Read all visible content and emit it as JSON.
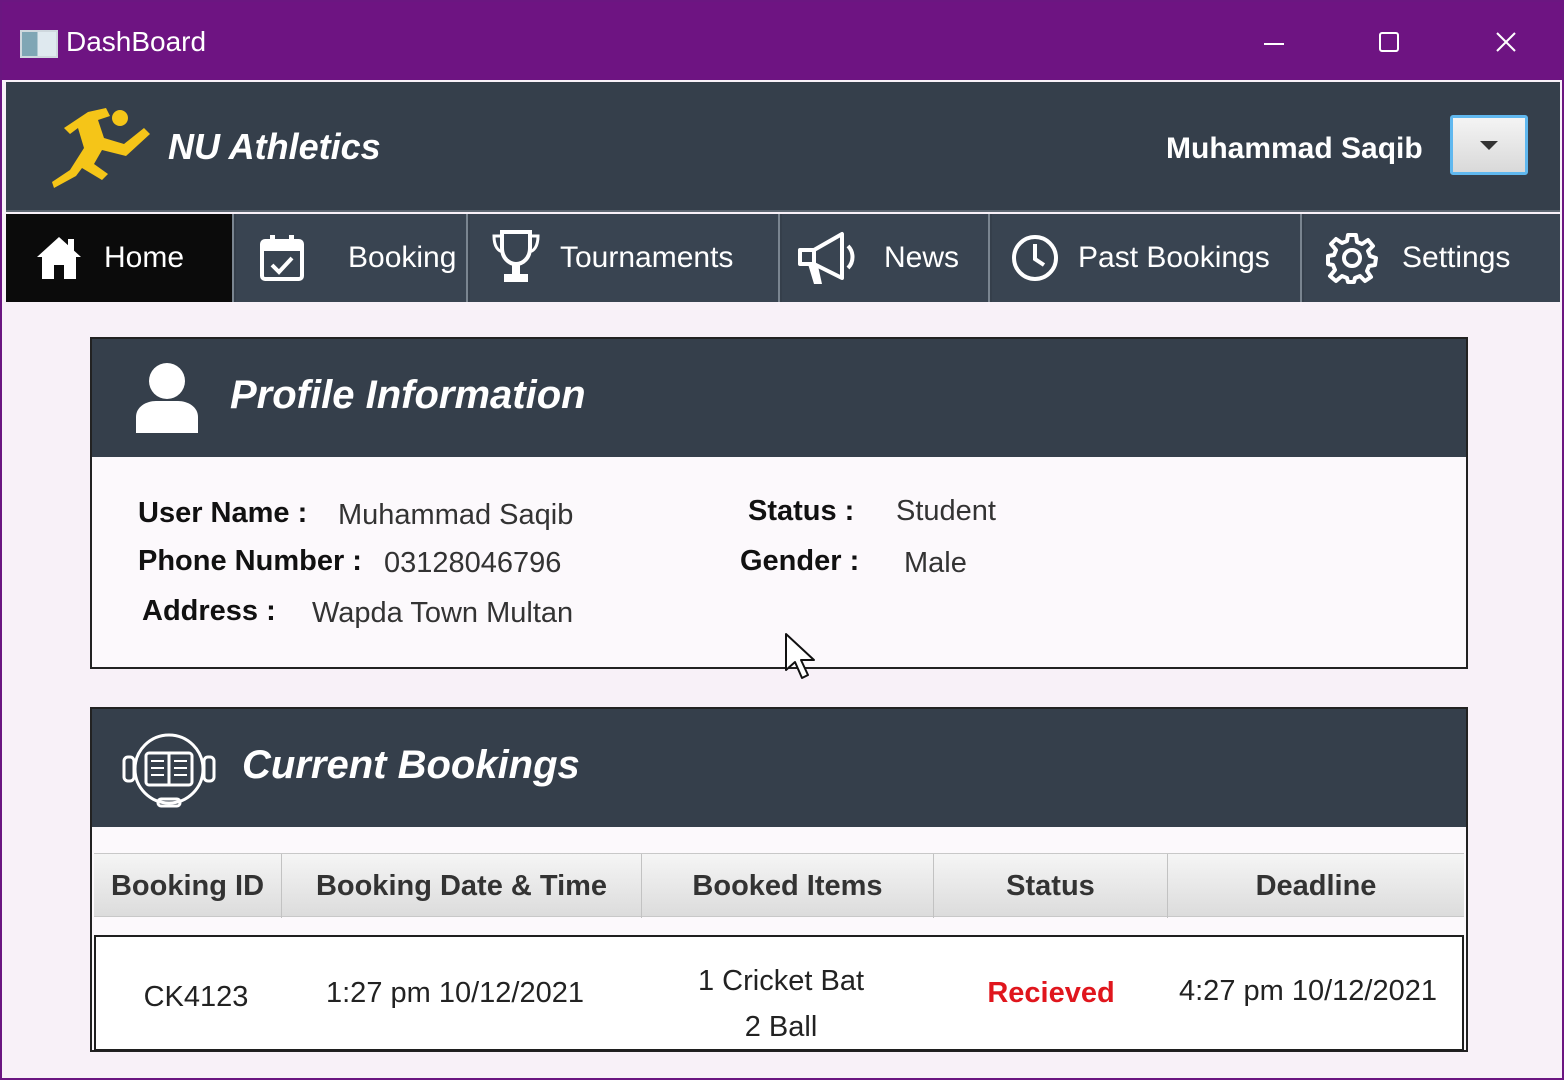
{
  "window": {
    "title": "DashBoard",
    "controls": [
      "minimize",
      "maximize",
      "close"
    ]
  },
  "header": {
    "brand": "NU Athletics",
    "user_name": "Muhammad Saqib",
    "logo_icon": "runner-icon"
  },
  "nav": {
    "items": [
      {
        "label": "Home",
        "icon": "home-icon",
        "active": true
      },
      {
        "label": "Booking",
        "icon": "calendar-check-icon",
        "active": false
      },
      {
        "label": "Tournaments",
        "icon": "trophy-icon",
        "active": false
      },
      {
        "label": "News",
        "icon": "megaphone-icon",
        "active": false
      },
      {
        "label": "Past Bookings",
        "icon": "clock-icon",
        "active": false
      },
      {
        "label": "Settings",
        "icon": "gear-icon",
        "active": false
      }
    ]
  },
  "profile": {
    "title": "Profile Information",
    "user_name_label": "User Name :",
    "user_name": "Muhammad Saqib",
    "phone_label": "Phone Number :",
    "phone": "03128046796",
    "address_label": "Address :",
    "address": "Wapda Town Multan",
    "status_label": "Status :",
    "status": "Student",
    "gender_label": "Gender :",
    "gender": "Male"
  },
  "bookings": {
    "title": "Current Bookings",
    "columns": [
      "Booking ID",
      "Booking Date & Time",
      "Booked Items",
      "Status",
      "Deadline"
    ],
    "rows": [
      {
        "id": "CK4123",
        "datetime": "1:27 pm 10/12/2021",
        "items": [
          "1 Cricket Bat",
          "2 Ball"
        ],
        "status": "Recieved",
        "deadline": "4:27 pm 10/12/2021"
      }
    ]
  },
  "colors": {
    "titlebar": "#6e1482",
    "header": "#353f4b",
    "nav_active": "#0b0b0b",
    "accent_logo": "#f5c518",
    "status_received": "#e0161d"
  }
}
